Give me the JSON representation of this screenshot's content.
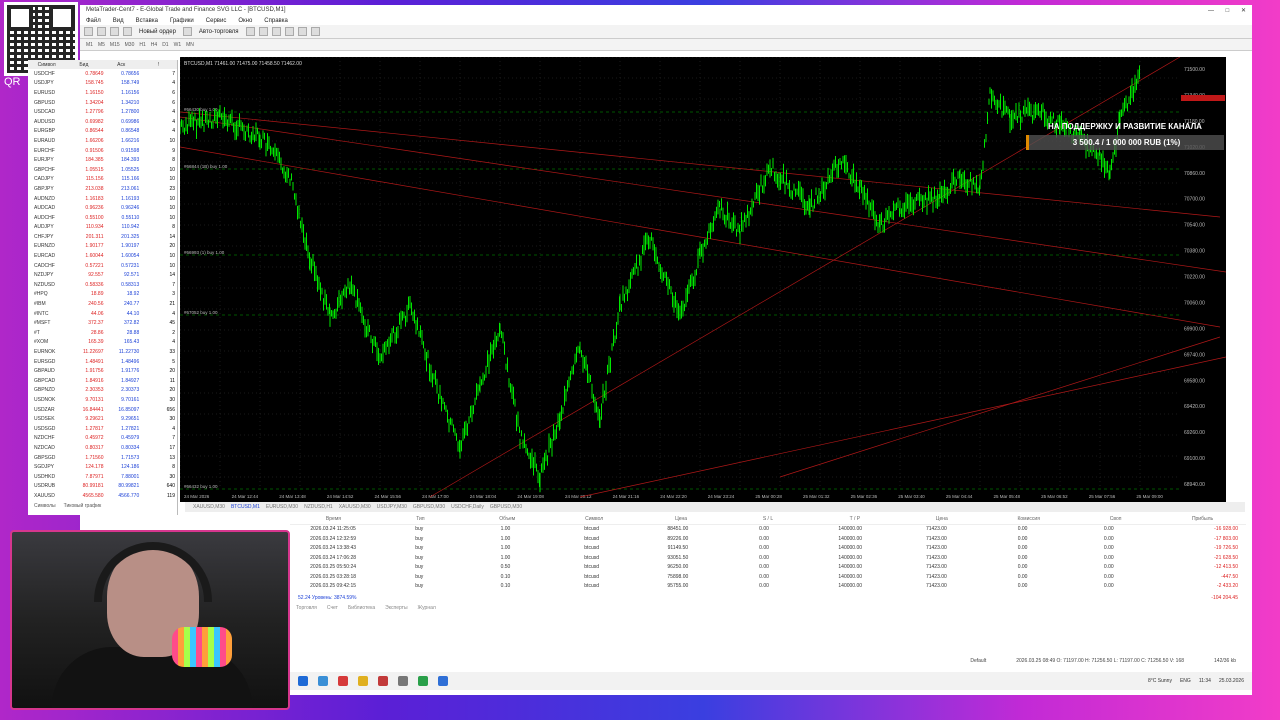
{
  "qr_label": "QR",
  "window": {
    "title": "MetaTrader-Cent7 - E-Global Trade and Finance SVG LLC - [BTCUSD,M1]",
    "controls": [
      "—",
      "□",
      "✕"
    ]
  },
  "menu": [
    "Файл",
    "Вид",
    "Вставка",
    "Графики",
    "Сервис",
    "Окно",
    "Справка"
  ],
  "toolbar": {
    "new_order": "Новый ордер",
    "auto_trading": "Авто-торговля"
  },
  "timeframes": [
    "M1",
    "M5",
    "M15",
    "M30",
    "H1",
    "H4",
    "D1",
    "W1",
    "MN"
  ],
  "watchlist": {
    "headers": [
      "Символ",
      "Бид",
      "Аск",
      "!"
    ],
    "rows": [
      [
        "USDCHF",
        "0.78649",
        "0.78656",
        "7"
      ],
      [
        "USDJPY",
        "158.745",
        "158.749",
        "4"
      ],
      [
        "EURUSD",
        "1.16150",
        "1.16156",
        "6"
      ],
      [
        "GBPUSD",
        "1.34204",
        "1.34210",
        "6"
      ],
      [
        "USDCAD",
        "1.27796",
        "1.27800",
        "4"
      ],
      [
        "AUDUSD",
        "0.69982",
        "0.69986",
        "4"
      ],
      [
        "EURGBP",
        "0.86544",
        "0.86548",
        "4"
      ],
      [
        "EURAUD",
        "1.66206",
        "1.66216",
        "10"
      ],
      [
        "EURCHF",
        "0.91506",
        "0.91598",
        "9"
      ],
      [
        "EURJPY",
        "184.385",
        "184.393",
        "8"
      ],
      [
        "GBPCHF",
        "1.05515",
        "1.05525",
        "10"
      ],
      [
        "CADJPY",
        "115.156",
        "115.166",
        "10"
      ],
      [
        "GBPJPY",
        "213.038",
        "213.061",
        "23"
      ],
      [
        "AUDNZD",
        "1.16183",
        "1.16193",
        "10"
      ],
      [
        "AUDCAD",
        "0.96236",
        "0.96246",
        "10"
      ],
      [
        "AUDCHF",
        "0.55100",
        "0.55110",
        "10"
      ],
      [
        "AUDJPY",
        "110.934",
        "110.942",
        "8"
      ],
      [
        "CHFJPY",
        "201.311",
        "201.325",
        "14"
      ],
      [
        "EURNZD",
        "1.90177",
        "1.90197",
        "20"
      ],
      [
        "EURCAD",
        "1.60044",
        "1.60054",
        "10"
      ],
      [
        "CADCHF",
        "0.57221",
        "0.57231",
        "10"
      ],
      [
        "NZDJPY",
        "92.557",
        "92.571",
        "14"
      ],
      [
        "NZDUSD",
        "0.58336",
        "0.58313",
        "7"
      ],
      [
        "#HPQ",
        "18.89",
        "18.92",
        "3"
      ],
      [
        "#IBM",
        "240.56",
        "240.77",
        "21"
      ],
      [
        "#INTC",
        "44.06",
        "44.10",
        "4"
      ],
      [
        "#MSFT",
        "372.37",
        "372.82",
        "45"
      ],
      [
        "#T",
        "28.86",
        "28.88",
        "2"
      ],
      [
        "#XOM",
        "165.39",
        "165.43",
        "4"
      ],
      [
        "EURNOK",
        "11.22697",
        "11.22730",
        "33"
      ],
      [
        "EURSGD",
        "1.48491",
        "1.48496",
        "5"
      ],
      [
        "GBPAUD",
        "1.91756",
        "1.91776",
        "20"
      ],
      [
        "GBPCAD",
        "1.84916",
        "1.84927",
        "11"
      ],
      [
        "GBPNZD",
        "2.30353",
        "2.30373",
        "20"
      ],
      [
        "USDNOK",
        "9.70131",
        "9.70161",
        "30"
      ],
      [
        "USDZAR",
        "16.84441",
        "16.85097",
        "656"
      ],
      [
        "USDSEK",
        "9.29621",
        "9.29651",
        "30"
      ],
      [
        "USDSGD",
        "1.27817",
        "1.27821",
        "4"
      ],
      [
        "NZDCHF",
        "0.45972",
        "0.45979",
        "7"
      ],
      [
        "NZDCAD",
        "0.80317",
        "0.80334",
        "17"
      ],
      [
        "GBPSGD",
        "1.71560",
        "1.71573",
        "13"
      ],
      [
        "SGDJPY",
        "124.178",
        "124.186",
        "8"
      ],
      [
        "USDHKD",
        "7.87971",
        "7.88001",
        "30"
      ],
      [
        "USDRUB",
        "80.99181",
        "80.99821",
        "640"
      ],
      [
        "XAUUSD",
        "4565.580",
        "4566.770",
        "119"
      ]
    ]
  },
  "watch_tabs": [
    "Символы",
    "Тиковый график"
  ],
  "chart": {
    "header": "BTCUSD,M1 71461.00 71475.00 71458.50 71462.00",
    "price_labels": [
      "71500.00",
      "71340.00",
      "71180.00",
      "71020.00",
      "70860.00",
      "70700.00",
      "70540.00",
      "70380.00",
      "70220.00",
      "70060.00",
      "69900.00",
      "69740.00",
      "69580.00",
      "69420.00",
      "69260.00",
      "69100.00",
      "68940.00"
    ],
    "time_labels": [
      "24 Mar 2026",
      "24 Mar 12:44",
      "24 Mar 13:48",
      "24 Mar 14:52",
      "24 Mar 15:56",
      "24 Mar 17:00",
      "24 Mar 18:04",
      "24 Mar 19:08",
      "24 Mar 20:12",
      "24 Mar 21:16",
      "24 Mar 22:20",
      "24 Mar 23:24",
      "25 Mar 00:28",
      "25 Mar 01:32",
      "25 Mar 02:36",
      "25 Mar 03:40",
      "25 Mar 04:44",
      "25 Mar 05:48",
      "25 Mar 06:52",
      "25 Mar 07:56",
      "25 Mar 09:00"
    ],
    "order_labels": [
      "#66430 buy 1.00",
      "#66844 (1B) buy 1.00",
      "#66993 (1) buy 1.00",
      "#67052 buy 1.00",
      "#66432 buy 1.00"
    ],
    "series_color": "#00e600",
    "support_title": "НА ПОДДЕРЖКУ И РАЗВИТИЕ КАНАЛА",
    "support_amount": "3 500.4 / 1 000 000 RUB (1%)"
  },
  "chart_tabs": [
    "XAUUSD,M30",
    "BTCUSD,M1",
    "EURUSD,M30",
    "NZDUSD,H1",
    "XAUUSD,M30",
    "USDJPY,M30",
    "GBPUSD,M30",
    "USDCHF,Daily",
    "GBPUSD,M30"
  ],
  "terminal": {
    "headers": [
      "Время",
      "Тип",
      "Объем",
      "Символ",
      "Цена",
      "S / L",
      "T / P",
      "Цена",
      "Комиссия",
      "Своп",
      "Прибыль"
    ],
    "rows": [
      [
        "2026.03.24 11:25:05",
        "buy",
        "1.00",
        "btcusd",
        "88451.00",
        "0.00",
        "140000.00",
        "71423.00",
        "0.00",
        "0.00",
        "-16 928.00"
      ],
      [
        "2026.03.24 12:32:59",
        "buy",
        "1.00",
        "btcusd",
        "89226.00",
        "0.00",
        "140000.00",
        "71423.00",
        "0.00",
        "0.00",
        "-17 803.00"
      ],
      [
        "2026.03.24 13:38:43",
        "buy",
        "1.00",
        "btcusd",
        "91149.50",
        "0.00",
        "140000.00",
        "71423.00",
        "0.00",
        "0.00",
        "-19 726.50"
      ],
      [
        "2026.03.24 17:06:28",
        "buy",
        "1.00",
        "btcusd",
        "93051.50",
        "0.00",
        "140000.00",
        "71423.00",
        "0.00",
        "0.00",
        "-21 628.50"
      ],
      [
        "2026.03.25 05:50:24",
        "buy",
        "0.50",
        "btcusd",
        "96250.00",
        "0.00",
        "140000.00",
        "71423.00",
        "0.00",
        "0.00",
        "-12 413.50"
      ],
      [
        "2026.03.25 03:28:18",
        "buy",
        "0.10",
        "btcusd",
        "75898.00",
        "0.00",
        "140000.00",
        "71423.00",
        "0.00",
        "0.00",
        "-447.50"
      ],
      [
        "2026.03.25 09:42:15",
        "buy",
        "0.10",
        "btcusd",
        "95755.00",
        "0.00",
        "140000.00",
        "71423.00",
        "0.00",
        "0.00",
        "-2 433.20"
      ]
    ],
    "total_left": "52.24 Уровень: 3874.59%",
    "total_right": "-104 204.45",
    "tabs": [
      "Торговля",
      "Счет",
      "Библиотека",
      "Эксперты",
      "Журнал"
    ]
  },
  "status": {
    "profile": "Default",
    "info": "2026.03.25 08:49   O: 71197.00  H: 71256.50  L: 71197.00  C: 71256.50  V: 168",
    "traffic": "142/36 kb"
  },
  "tray": {
    "weather": "8°C Sunny",
    "lang": "ENG",
    "time": "11:34",
    "date": "25.03.2026"
  }
}
